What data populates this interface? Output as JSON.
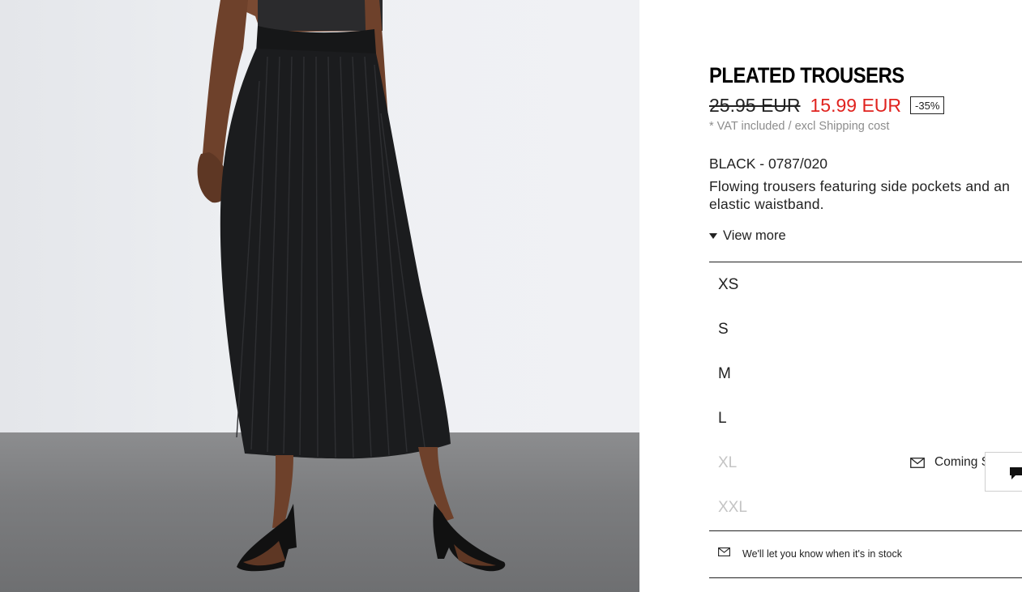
{
  "image": {
    "alt": "Model wearing black pleated trousers",
    "background": "#e9ebee",
    "floor": "#7c7d7f"
  },
  "product": {
    "title": "PLEATED TROUSERS",
    "old_price": "25.95 EUR",
    "new_price": "15.99 EUR",
    "discount": "-35%",
    "vat_note": "* VAT included / excl Shipping cost",
    "color_ref": "BLACK - 0787/020",
    "description": "Flowing trousers featuring side pockets and an elastic waistband.",
    "view_more": "View more",
    "price_color": "#e0231f"
  },
  "sizes": [
    {
      "label": "XS",
      "available": true
    },
    {
      "label": "S",
      "available": true
    },
    {
      "label": "M",
      "available": true
    },
    {
      "label": "L",
      "available": true
    },
    {
      "label": "XL",
      "available": false,
      "status": "Coming S",
      "icon": "envelope-icon"
    },
    {
      "label": "XXL",
      "available": false
    }
  ],
  "notify": {
    "text": "We'll let you know when it's in stock",
    "icon": "envelope-icon"
  },
  "chat": {
    "icon": "chat-bubble-icon"
  }
}
